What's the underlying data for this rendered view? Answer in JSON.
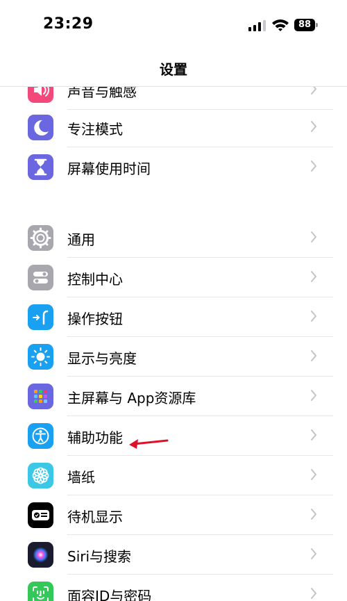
{
  "status_bar": {
    "time": "23:29",
    "battery": "88"
  },
  "nav": {
    "title": "设置"
  },
  "settings": [
    {
      "label": "声音与触感",
      "icon": "speaker-icon",
      "color": "#f2487a"
    },
    {
      "label": "专注模式",
      "icon": "moon-icon",
      "color": "#6a67e0"
    },
    {
      "label": "屏幕使用时间",
      "icon": "hourglass-icon",
      "color": "#6a67e0"
    },
    {
      "label": "通用",
      "icon": "gear-icon",
      "color": "#a7a7ad"
    },
    {
      "label": "控制中心",
      "icon": "toggles-icon",
      "color": "#a7a7ad"
    },
    {
      "label": "操作按钮",
      "icon": "action-button-icon",
      "color": "#1aa0f0"
    },
    {
      "label": "显示与亮度",
      "icon": "sun-icon",
      "color": "#1aa0f0"
    },
    {
      "label": "主屏幕与 App资源库",
      "icon": "app-grid-icon",
      "color": "#6a67e0"
    },
    {
      "label": "辅助功能",
      "icon": "accessibility-icon",
      "color": "#1aa0f0"
    },
    {
      "label": "墙纸",
      "icon": "flower-icon",
      "color": "#3cc7e6"
    },
    {
      "label": "待机显示",
      "icon": "standby-icon",
      "color": "#000000"
    },
    {
      "label": "Siri与搜索",
      "icon": "siri-icon",
      "color": "#1b1b2f"
    },
    {
      "label": "面容ID与密码",
      "icon": "face-id-icon",
      "color": "#34c759"
    }
  ],
  "annotation": {
    "color": "#e0102a"
  }
}
